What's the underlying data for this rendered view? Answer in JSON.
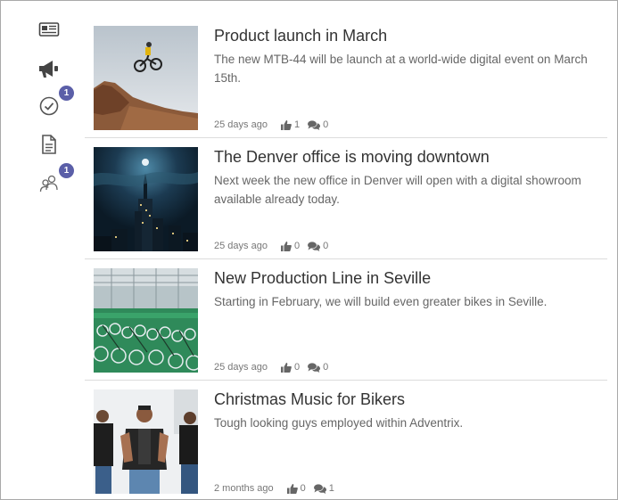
{
  "sidebar": {
    "items": [
      {
        "icon": "news-icon",
        "badge": ""
      },
      {
        "icon": "megaphone-icon",
        "badge": ""
      },
      {
        "icon": "check-circle-icon",
        "badge": "1"
      },
      {
        "icon": "document-icon",
        "badge": ""
      },
      {
        "icon": "people-icon",
        "badge": "1"
      }
    ],
    "badge_color": "#5b5fa8"
  },
  "feed": [
    {
      "title": "Product launch in March",
      "description": "The new MTB-44 will be launch at a world-wide digital event on March 15th.",
      "time": "25 days ago",
      "likes": "1",
      "comments": "0",
      "image": "mountain-biker-jump"
    },
    {
      "title": "The Denver office is moving downtown",
      "description": "Next week the new office in Denver will open with a digital showroom available already today.",
      "time": "25 days ago",
      "likes": "0",
      "comments": "0",
      "image": "city-skyline-night"
    },
    {
      "title": "New Production Line in Seville",
      "description": "Starting in February, we will build even greater bikes in Seville.",
      "time": "25 days ago",
      "likes": "0",
      "comments": "0",
      "image": "bike-factory-floor"
    },
    {
      "title": "Christmas Music for Bikers",
      "description": "Tough looking guys employed within Adventrix.",
      "time": "2 months ago",
      "likes": "0",
      "comments": "1",
      "image": "bikers-group-street"
    }
  ]
}
